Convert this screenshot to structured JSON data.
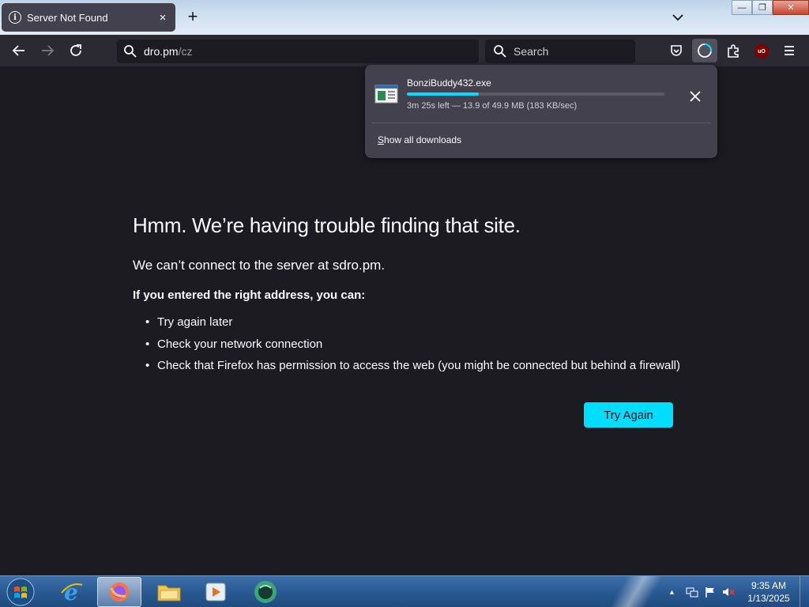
{
  "tab": {
    "title": "Server Not Found",
    "icon": "info-icon",
    "close": "×",
    "new_tab": "+"
  },
  "window_controls": {
    "minimize": "—",
    "maximize": "❐",
    "close": "✕"
  },
  "nav": {
    "url_host": "dro.pm",
    "url_path": "/cz",
    "search_placeholder": "Search"
  },
  "extensions": {
    "ublock_label": "uO"
  },
  "downloads_panel": {
    "file_name": "BonziBuddy432.exe",
    "progress": 0.28,
    "status": "3m 25s left — 13.9 of 49.9 MB (183 KB/sec)",
    "show_all_accesskey": "S",
    "show_all_rest": "how all downloads"
  },
  "error_page": {
    "title": "Hmm. We’re having trouble finding that site.",
    "description": "We can’t connect to the server at sdro.pm.",
    "subtitle": "If you entered the right address, you can:",
    "suggestions": [
      "Try again later",
      "Check your network connection",
      "Check that Firefox has permission to access the web (you might be connected but behind a firewall)"
    ],
    "try_again": "Try Again"
  },
  "taskbar": {
    "apps": [
      "internet-explorer",
      "firefox",
      "file-explorer",
      "media-player",
      "bonzibuddy"
    ],
    "active_app": "firefox",
    "time": "9:35 AM",
    "date": "1/13/2025"
  },
  "colors": {
    "accent": "#00ddff",
    "page_bg": "#1c1b22",
    "toolbar_bg": "#2b2a33",
    "panel_bg": "#42414d"
  }
}
